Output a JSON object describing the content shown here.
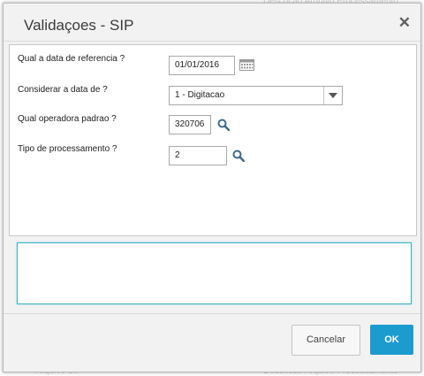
{
  "dialog": {
    "title": "Validaçoes - SIP",
    "close_icon": "close-icon"
  },
  "form": {
    "data_referencia": {
      "label": "Qual a data de referencia ?",
      "value": "01/01/2016",
      "icon": "calendar-icon"
    },
    "considerar_data": {
      "label": "Considerar a data de ?",
      "value": "1 - Digitacao",
      "icon": "chevron-down-icon"
    },
    "operadora_padrao": {
      "label": "Qual operadora padrao ?",
      "value": "320706",
      "icon": "search-icon"
    },
    "tipo_processamento": {
      "label": "Tipo de processamento ?",
      "value": "2",
      "icon": "search-icon"
    }
  },
  "description_text": "",
  "buttons": {
    "cancel_label": "Cancelar",
    "ok_label": "OK"
  },
  "colors": {
    "accent": "#1c9bcf",
    "focus_border": "#3bb4c6"
  }
}
